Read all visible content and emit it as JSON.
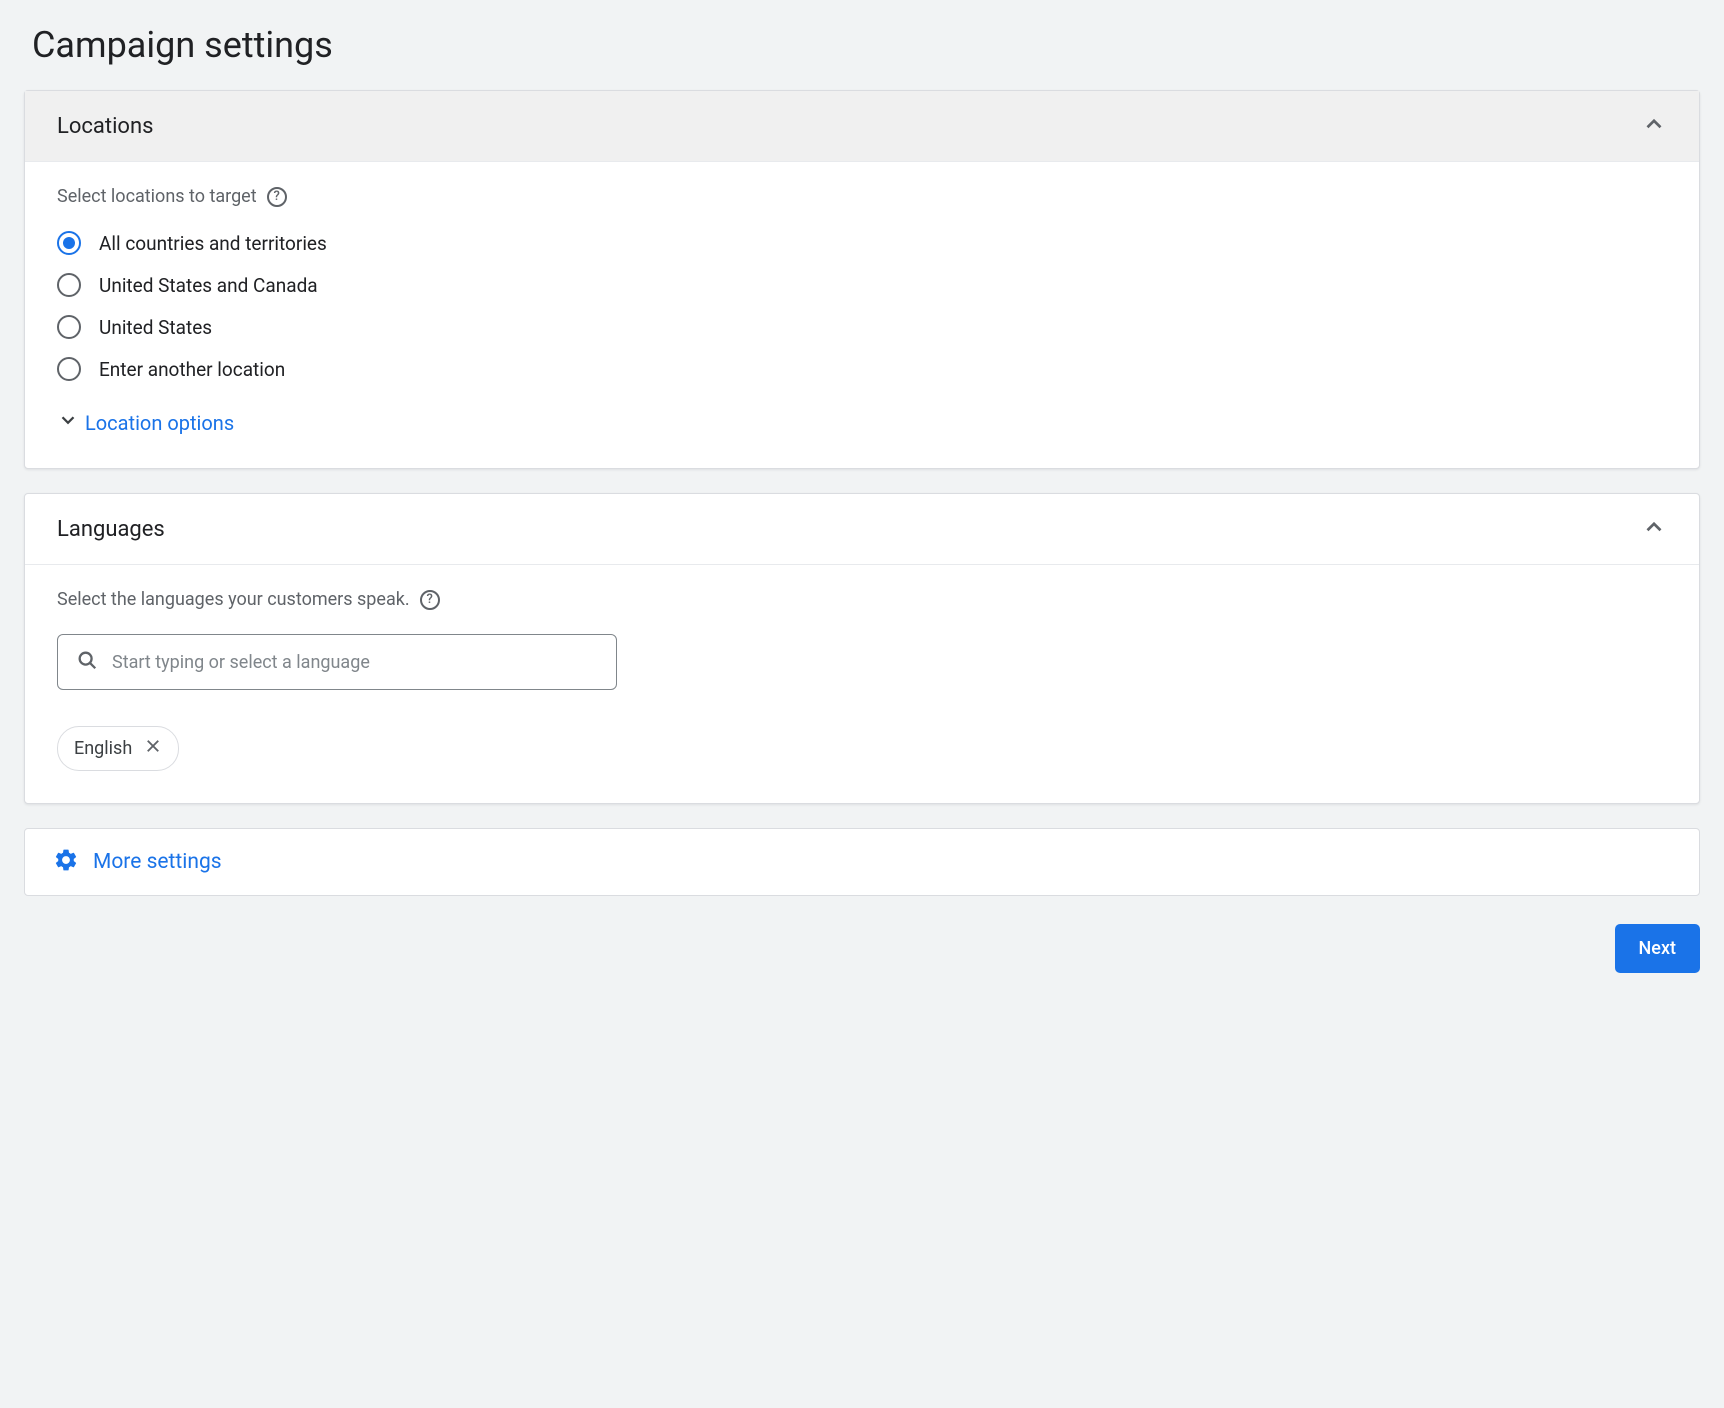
{
  "page": {
    "title": "Campaign settings"
  },
  "locations": {
    "title": "Locations",
    "subtitle": "Select locations to target",
    "options": {
      "opt0": "All countries and territories",
      "opt1": "United States and Canada",
      "opt2": "United States",
      "opt3": "Enter another location"
    },
    "location_options_label": "Location options"
  },
  "languages": {
    "title": "Languages",
    "subtitle": "Select the languages your customers speak.",
    "search_placeholder": "Start typing or select a language",
    "chips": {
      "chip0": "English"
    }
  },
  "more_settings": {
    "label": "More settings"
  },
  "footer": {
    "next_label": "Next"
  }
}
